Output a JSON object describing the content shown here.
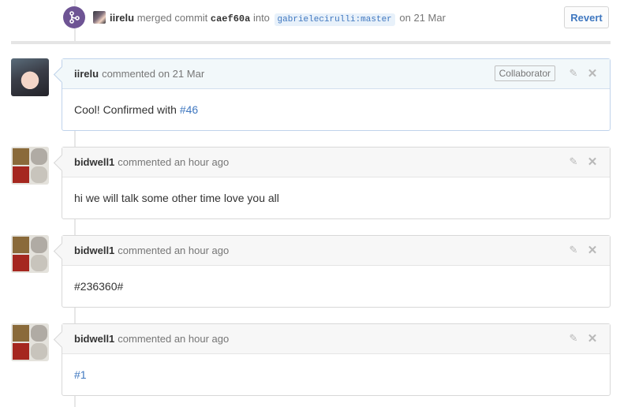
{
  "merge_event": {
    "user": "iirelu",
    "action": "merged commit",
    "sha": "caef60a",
    "into": "into",
    "branch": "gabrielecirulli:master",
    "date": "on 21 Mar",
    "revert_label": "Revert"
  },
  "comments": [
    {
      "author": "iirelu",
      "meta": "commented on 21 Mar",
      "badge": "Collaborator",
      "body_prefix": "Cool! Confirmed with ",
      "body_link": "#46"
    },
    {
      "author": "bidwell1",
      "meta": "commented an hour ago",
      "body": "hi we will talk some other time love you all"
    },
    {
      "author": "bidwell1",
      "meta": "commented an hour ago",
      "body": "#236360#"
    },
    {
      "author": "bidwell1",
      "meta": "commented an hour ago",
      "body_link": "#1"
    }
  ],
  "icons": {
    "merge": "git-merge-icon",
    "edit": "pencil-icon",
    "close": "x-icon"
  },
  "colors": {
    "merge_badge": "#6e5494",
    "link": "#4078c0",
    "highlight_header": "#f2f8fa"
  }
}
